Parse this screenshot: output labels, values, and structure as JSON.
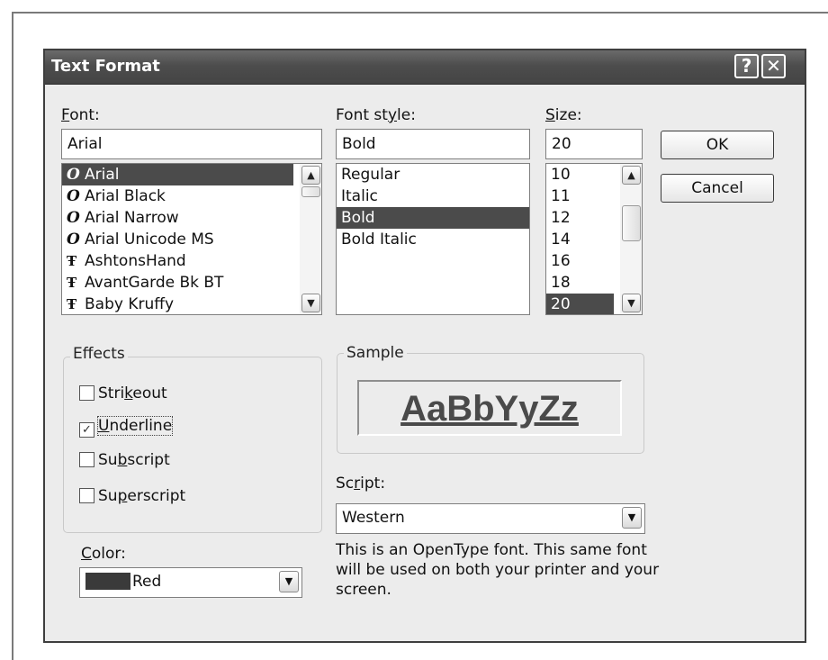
{
  "dialog": {
    "title": "Text Format",
    "help_button": "?",
    "close_button": "✕"
  },
  "font": {
    "label": "Font:",
    "value": "Arial",
    "items": [
      {
        "name": "Arial",
        "icon": "opentype-font-icon",
        "selected": true
      },
      {
        "name": "Arial Black",
        "icon": "opentype-font-icon",
        "selected": false
      },
      {
        "name": "Arial Narrow",
        "icon": "opentype-font-icon",
        "selected": false
      },
      {
        "name": "Arial Unicode MS",
        "icon": "opentype-font-icon",
        "selected": false
      },
      {
        "name": "AshtonsHand",
        "icon": "truetype-font-icon",
        "selected": false
      },
      {
        "name": "AvantGarde Bk BT",
        "icon": "truetype-font-icon",
        "selected": false
      },
      {
        "name": "Baby Kruffy",
        "icon": "truetype-font-icon",
        "selected": false
      }
    ]
  },
  "font_style": {
    "label": "Font style:",
    "value": "Bold",
    "items": [
      {
        "name": "Regular",
        "selected": false
      },
      {
        "name": "Italic",
        "selected": false
      },
      {
        "name": "Bold",
        "selected": true
      },
      {
        "name": "Bold Italic",
        "selected": false
      }
    ]
  },
  "size": {
    "label": "Size:",
    "value": "20",
    "items": [
      {
        "name": "10",
        "selected": false
      },
      {
        "name": "11",
        "selected": false
      },
      {
        "name": "12",
        "selected": false
      },
      {
        "name": "14",
        "selected": false
      },
      {
        "name": "16",
        "selected": false
      },
      {
        "name": "18",
        "selected": false
      },
      {
        "name": "20",
        "selected": true
      }
    ]
  },
  "buttons": {
    "ok": "OK",
    "cancel": "Cancel"
  },
  "effects": {
    "title": "Effects",
    "strikeout": {
      "label": "Strikeout",
      "checked": false
    },
    "underline": {
      "label": "Underline",
      "checked": true
    },
    "subscript": {
      "label": "Subscript",
      "checked": false
    },
    "superscript": {
      "label": "Superscript",
      "checked": false
    }
  },
  "color": {
    "label": "Color:",
    "value": "Red"
  },
  "sample": {
    "title": "Sample",
    "text": "AaBbYyZz"
  },
  "script": {
    "label": "Script:",
    "value": "Western"
  },
  "info": "This is an OpenType font. This same font will be used on both your printer and your screen.",
  "colors": {
    "titlebar": "#4d4d4d",
    "selection": "#4b4b4b",
    "dialog_bg": "#ececec"
  }
}
